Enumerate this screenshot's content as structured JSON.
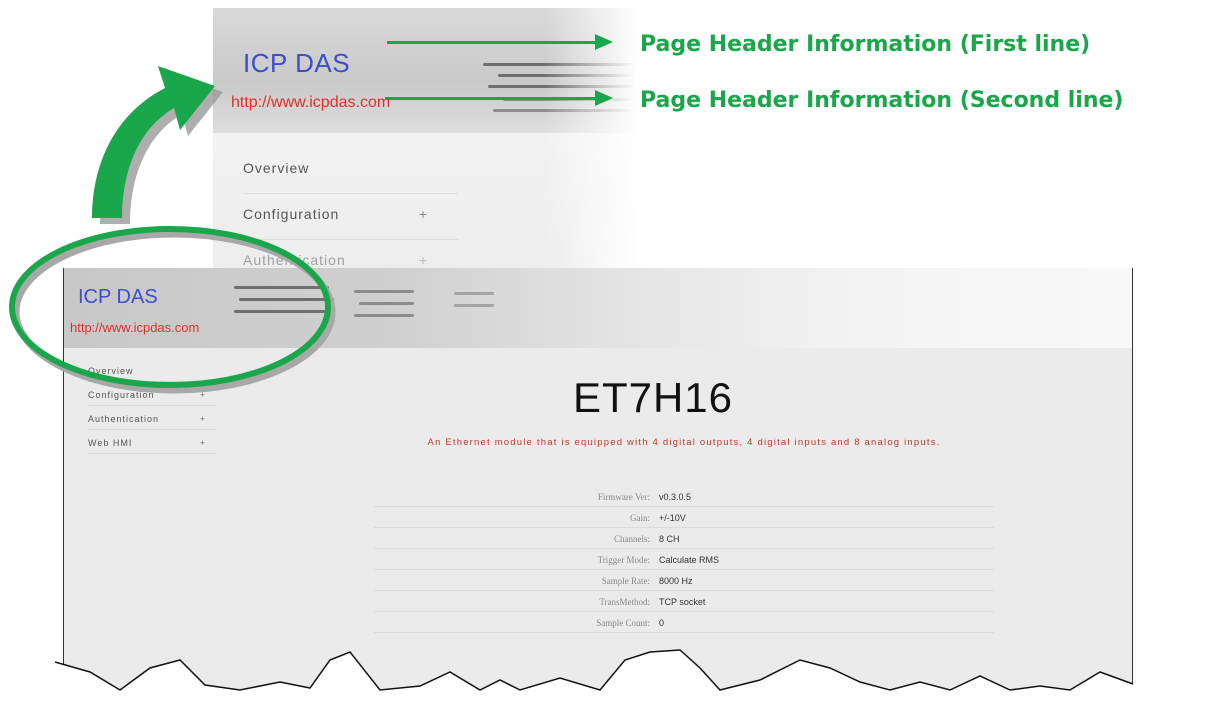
{
  "zoomed_header": {
    "brand": "ICP DAS",
    "url": "http://www.icpdas.com",
    "menu": [
      {
        "label": "Overview",
        "plus": ""
      },
      {
        "label": "Configuration",
        "plus": "+"
      },
      {
        "label": "Authentication",
        "plus": "+"
      }
    ]
  },
  "annotations": {
    "first_line": "Page Header Information (First line)",
    "second_line": "Page Header Information (Second line)"
  },
  "page": {
    "brand": "ICP DAS",
    "url": "http://www.icpdas.com",
    "menu": [
      {
        "label": "Overview",
        "plus": ""
      },
      {
        "label": "Configuration",
        "plus": "+"
      },
      {
        "label": "Authentication",
        "plus": "+"
      },
      {
        "label": "Web HMI",
        "plus": "+"
      }
    ],
    "title": "ET7H16",
    "description": "An Ethernet module that is equipped with 4 digital outputs, 4 digital inputs and 8 analog inputs.",
    "specs": [
      {
        "key": "Firmware Ver:",
        "value": "v0.3.0.5"
      },
      {
        "key": "Gain:",
        "value": "+/-10V"
      },
      {
        "key": "Channels:",
        "value": "8 CH"
      },
      {
        "key": "Trigger Mode:",
        "value": "Calculate RMS"
      },
      {
        "key": "Sample Rate:",
        "value": "8000 Hz"
      },
      {
        "key": "TransMethod:",
        "value": "TCP socket"
      },
      {
        "key": "Sample Count:",
        "value": "0"
      }
    ]
  },
  "colors": {
    "annotation_green": "#1aa64a",
    "brand_blue": "#3a4fcf",
    "url_red": "#e0302a",
    "description_red": "#c0392b"
  }
}
